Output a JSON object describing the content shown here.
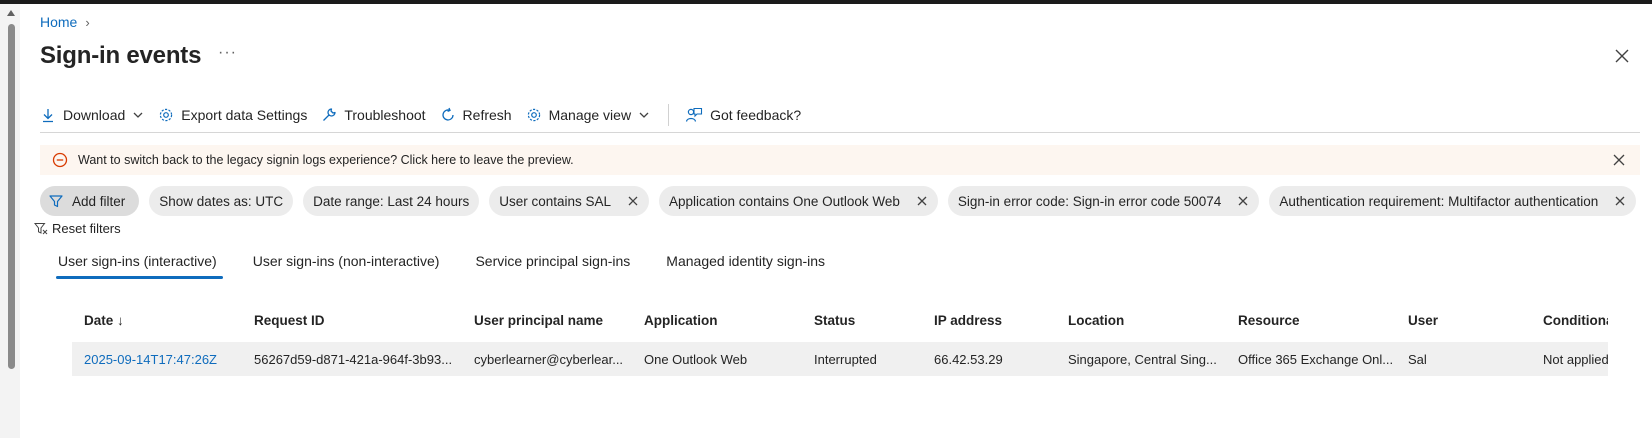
{
  "breadcrumb": {
    "home": "Home"
  },
  "page": {
    "title": "Sign-in events",
    "more": "···"
  },
  "toolbar": {
    "download": "Download",
    "export": "Export data Settings",
    "troubleshoot": "Troubleshoot",
    "refresh": "Refresh",
    "manage_view": "Manage view",
    "feedback": "Got feedback?"
  },
  "banner": {
    "text": "Want to switch back to the legacy signin logs experience? Click here to leave the preview."
  },
  "filters": {
    "add": "Add filter",
    "show_dates": "Show dates as: UTC",
    "date_range": "Date range: Last 24 hours",
    "user": "User contains SAL",
    "application": "Application contains One Outlook Web",
    "error_code": "Sign-in error code: Sign-in error code 50074",
    "auth_req": "Authentication requirement: Multifactor authentication",
    "reset": "Reset filters"
  },
  "tabs": [
    {
      "label": "User sign-ins (interactive)",
      "active": true
    },
    {
      "label": "User sign-ins (non-interactive)"
    },
    {
      "label": "Service principal sign-ins"
    },
    {
      "label": "Managed identity sign-ins"
    }
  ],
  "table": {
    "headers": [
      "Date ↓",
      "Request ID",
      "User principal name",
      "Application",
      "Status",
      "IP address",
      "Location",
      "Resource",
      "User",
      "Conditiona"
    ],
    "rows": [
      [
        "2025-09-14T17:47:26Z",
        "56267d59-d871-421a-964f-3b93...",
        "cyberlearner@cyberlear...",
        "One Outlook Web",
        "Interrupted",
        "66.42.53.29",
        "Singapore, Central Sing...",
        "Office 365 Exchange Onl...",
        "Sal",
        "Not applied"
      ]
    ]
  },
  "colors": {
    "accent": "#0f6cbd",
    "banner_bg": "#fdf6f0",
    "warn": "#d83b01"
  }
}
